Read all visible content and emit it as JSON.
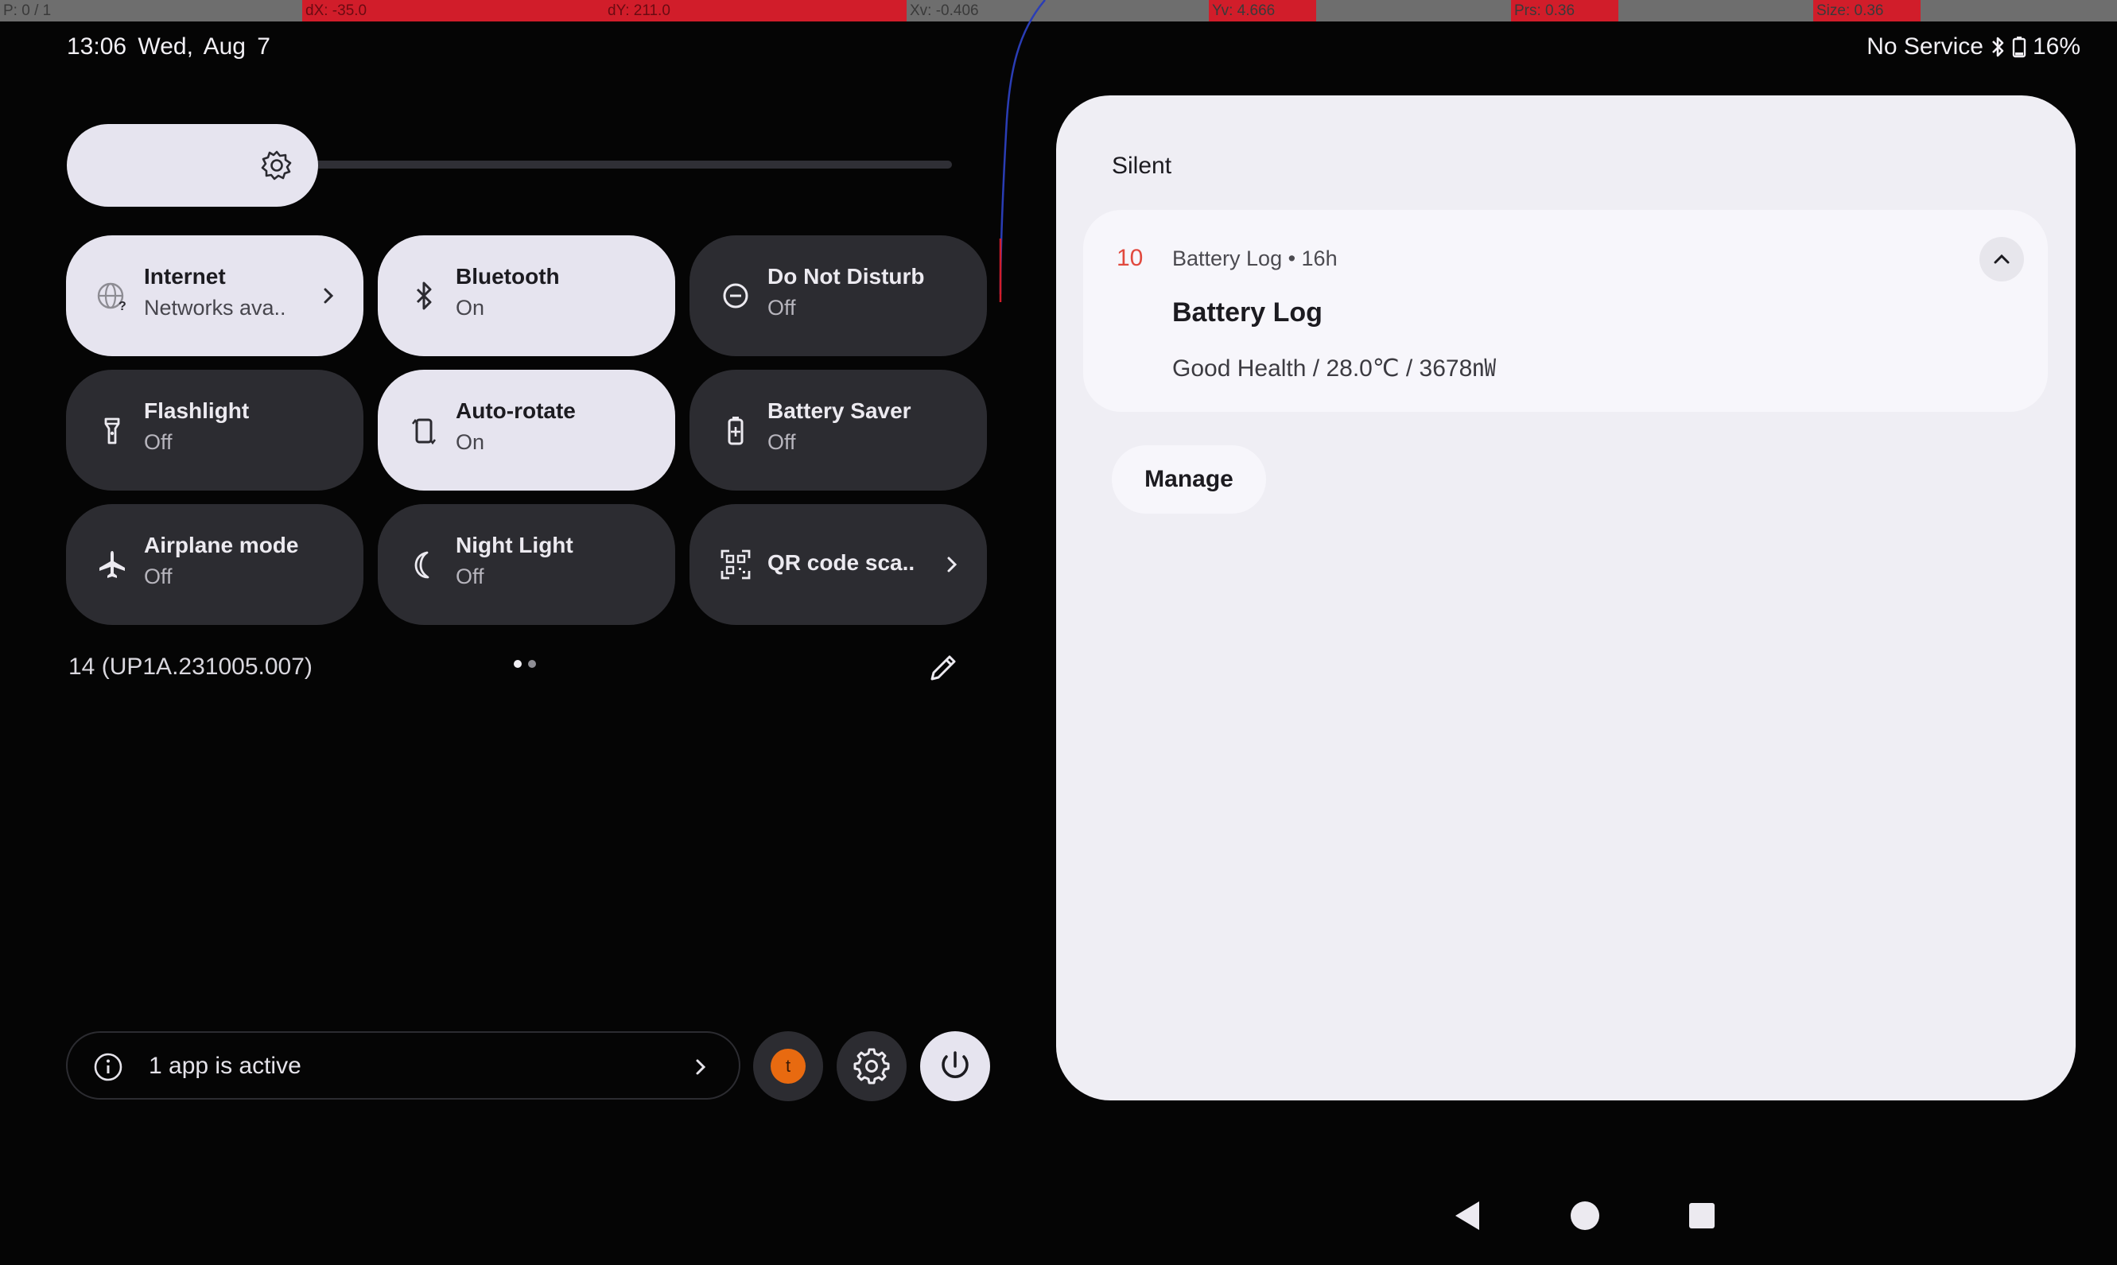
{
  "debug_bar": {
    "pointer": "P: 0 / 1",
    "dx": "dX: -35.0",
    "dy": "dY: 211.0",
    "xv": "Xv: -0.406",
    "yv": "Yv: 4.666",
    "prs": "Prs: 0.36",
    "size": "Size: 0.36"
  },
  "status_bar": {
    "time": "13:06",
    "date": "Wed, Aug 7",
    "network": "No Service",
    "battery": "16%",
    "icons": [
      "bluetooth-icon",
      "battery-icon"
    ]
  },
  "brightness": {
    "icon": "brightness-icon"
  },
  "tiles": [
    {
      "label": "Internet",
      "sub": "Networks ava..",
      "state": "on",
      "icon": "internet-icon",
      "chevron": true
    },
    {
      "label": "Bluetooth",
      "sub": "On",
      "state": "on",
      "icon": "bluetooth-icon"
    },
    {
      "label": "Do Not Disturb",
      "sub": "Off",
      "state": "off",
      "icon": "dnd-icon"
    },
    {
      "label": "Flashlight",
      "sub": "Off",
      "state": "off",
      "icon": "flashlight-icon"
    },
    {
      "label": "Auto-rotate",
      "sub": "On",
      "state": "on",
      "icon": "rotate-icon"
    },
    {
      "label": "Battery Saver",
      "sub": "Off",
      "state": "off",
      "icon": "battery-saver-icon"
    },
    {
      "label": "Airplane mode",
      "sub": "Off",
      "state": "off",
      "icon": "airplane-icon"
    },
    {
      "label": "Night Light",
      "sub": "Off",
      "state": "off",
      "icon": "night-light-icon"
    },
    {
      "label": "QR code sca..",
      "state": "off",
      "icon": "qr-code-icon",
      "chevron": true
    }
  ],
  "build": "14 (UP1A.231005.007)",
  "pages": {
    "current": 1,
    "total": 2
  },
  "active_apps": {
    "text": "1 app is active"
  },
  "user": {
    "initial": "t",
    "color": "#e86a10"
  },
  "notifications": {
    "section": "Silent",
    "items": [
      {
        "badge": "10",
        "app_meta": "Battery Log • 16h",
        "title": "Battery Log",
        "body": "Good Health / 28.0℃ / 3678㎻"
      }
    ],
    "manage_label": "Manage"
  },
  "colors": {
    "tile_on": "#e6e4ef",
    "tile_off": "#2c2c31",
    "accent_red": "#d11d2a",
    "panel": "#efeef4"
  }
}
